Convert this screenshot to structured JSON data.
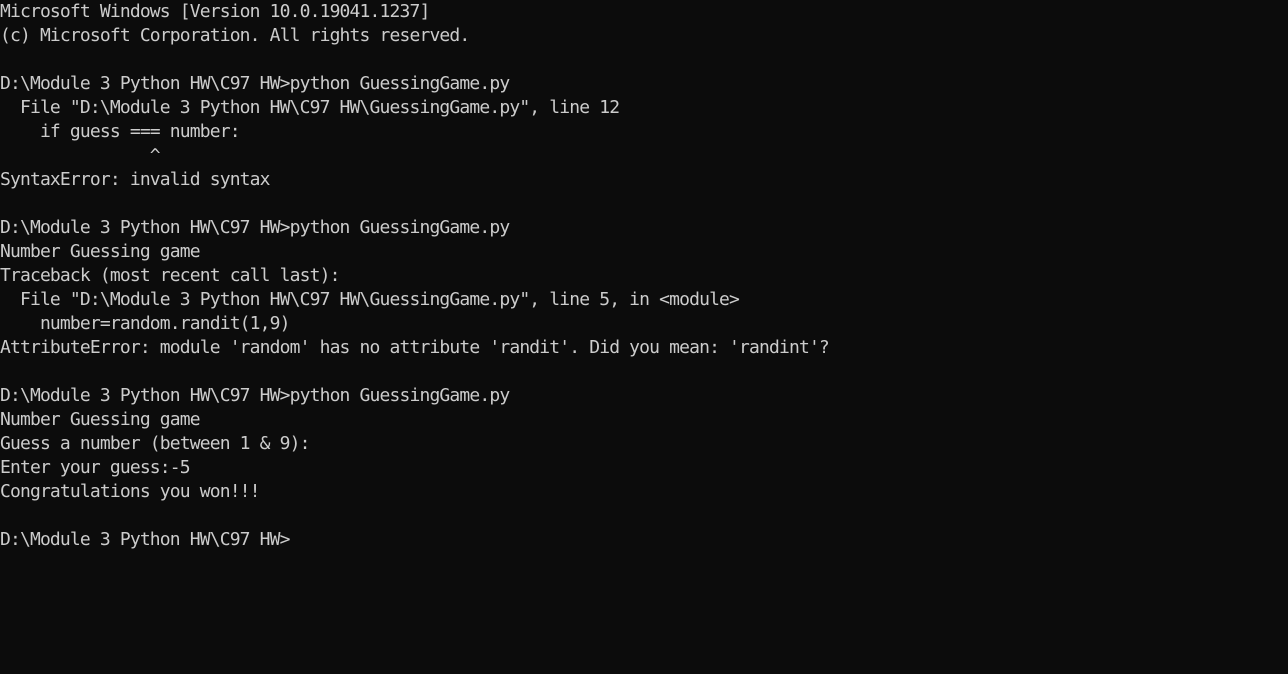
{
  "colors": {
    "background": "#0c0c0c",
    "text": "#cccccc"
  },
  "console": {
    "lines": [
      "Microsoft Windows [Version 10.0.19041.1237]",
      "(c) Microsoft Corporation. All rights reserved.",
      "",
      "D:\\Module 3 Python HW\\C97 HW>python GuessingGame.py",
      "  File \"D:\\Module 3 Python HW\\C97 HW\\GuessingGame.py\", line 12",
      "    if guess === number:",
      "               ^",
      "SyntaxError: invalid syntax",
      "",
      "D:\\Module 3 Python HW\\C97 HW>python GuessingGame.py",
      "Number Guessing game",
      "Traceback (most recent call last):",
      "  File \"D:\\Module 3 Python HW\\C97 HW\\GuessingGame.py\", line 5, in <module>",
      "    number=random.randit(1,9)",
      "AttributeError: module 'random' has no attribute 'randit'. Did you mean: 'randint'?",
      "",
      "D:\\Module 3 Python HW\\C97 HW>python GuessingGame.py",
      "Number Guessing game",
      "Guess a number (between 1 & 9):",
      "Enter your guess:-5",
      "Congratulations you won!!!",
      ""
    ],
    "current_prompt": "D:\\Module 3 Python HW\\C97 HW>",
    "current_input": ""
  }
}
